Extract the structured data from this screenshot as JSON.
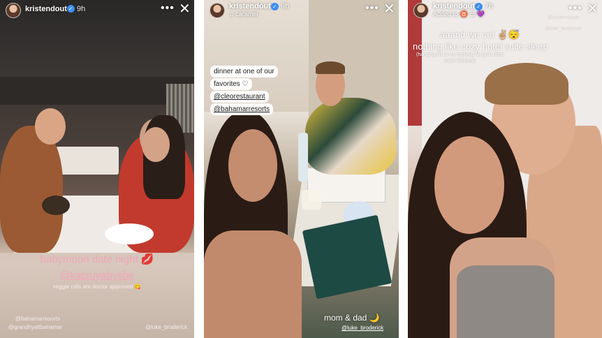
{
  "stories": [
    {
      "username": "kristendoute",
      "time": "9h",
      "caption_main": "babymoon date night 💋",
      "mention_main": "@katsuyabysbe",
      "caption_small": "veggie rolls are doctor approved 😋",
      "tag_left_1": "@bahamarresorts",
      "tag_left_2": "@grandhyattbahamar",
      "tag_right": "@luke_broderick"
    },
    {
      "username": "kristendoute",
      "time": "9h",
      "subtitle": "♫ caramel",
      "pill_line1": "dinner at one of our",
      "pill_line2": "favorites ♡",
      "pill_line3": "@cleorestaurant",
      "pill_line4": "@bahamarresorts",
      "caption_main": "mom & dad 🌙",
      "mention_main": "@luke_broderick"
    },
    {
      "username": "kristendoute",
      "time": "7h",
      "subtitle": "Added to ♉ ☰ 💜",
      "caption_line1": "aaand we out ✌🏼😴",
      "caption_line2": "nothing like cozy hotel suite sleep",
      "caption_small_1": "(hanging on to my makeup for just a few",
      "caption_small_2": "more minutes)",
      "tag_right_1": "@kristendoute",
      "tag_right_2": "@luke_broderick"
    }
  ],
  "icons": {
    "more": "more-horizontal-icon",
    "close": "close-icon",
    "verified": "verified-badge-icon"
  },
  "colors": {
    "caption_pink": "#f2a6b9",
    "verified_blue": "#3b8df5"
  }
}
